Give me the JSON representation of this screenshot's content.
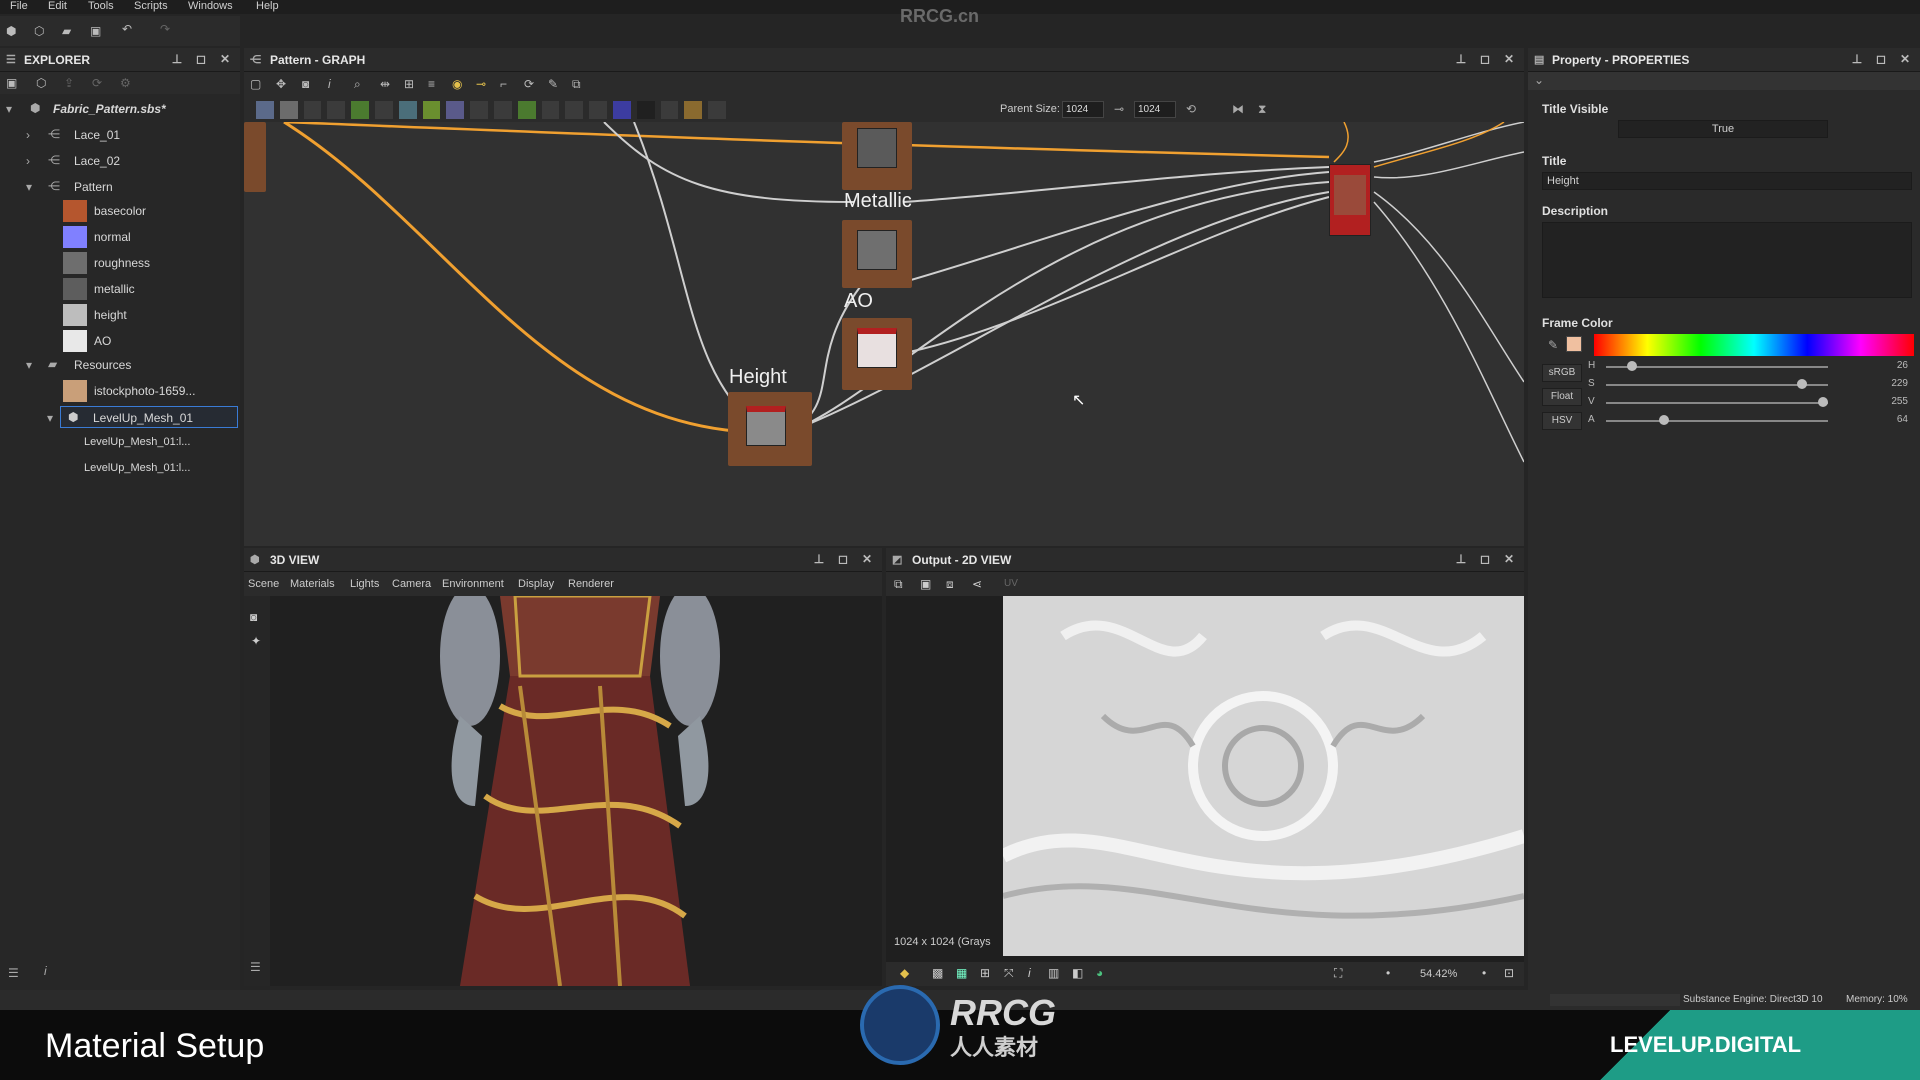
{
  "menu": [
    "File",
    "Edit",
    "Tools",
    "Scripts",
    "Windows",
    "Help"
  ],
  "watermark_top": "RRCG.cn",
  "explorer": {
    "title": "EXPLORER",
    "root": "Fabric_Pattern.sbs*",
    "items": [
      {
        "label": "Lace_01"
      },
      {
        "label": "Lace_02"
      },
      {
        "label": "Pattern"
      },
      {
        "label": "basecolor",
        "swatch": "#b5562e"
      },
      {
        "label": "normal",
        "swatch": "#8080ff"
      },
      {
        "label": "roughness",
        "swatch": "#6e6e6e"
      },
      {
        "label": "metallic",
        "swatch": "#5d5d5d"
      },
      {
        "label": "height",
        "swatch": "#bdbdbd"
      },
      {
        "label": "AO",
        "swatch": "#e8e8e8"
      },
      {
        "label": "Resources"
      },
      {
        "label": "istockphoto-1659...",
        "swatch": "#c99f79"
      },
      {
        "label": "LevelUp_Mesh_01"
      },
      {
        "label": "LevelUp_Mesh_01:l..."
      },
      {
        "label": "LevelUp_Mesh_01:l..."
      }
    ]
  },
  "graph": {
    "title": "Pattern - GRAPH",
    "parent_size_label": "Parent Size:",
    "parent_size": "1024",
    "size2": "1024",
    "nodes": [
      {
        "title": "Metallic"
      },
      {
        "title": "AO"
      },
      {
        "title": "Height"
      }
    ]
  },
  "properties": {
    "title": "Property - PROPERTIES",
    "title_visible_label": "Title Visible",
    "title_visible_value": "True",
    "title_label": "Title",
    "title_value": "Height",
    "description_label": "Description",
    "frame_color_label": "Frame Color",
    "modes": [
      "sRGB",
      "Float",
      "HSV"
    ],
    "sliders": [
      {
        "name": "H",
        "value": "26",
        "fraction": 0.1
      },
      {
        "name": "S",
        "value": "229",
        "fraction": 0.9
      },
      {
        "name": "V",
        "value": "255",
        "fraction": 1.0
      },
      {
        "name": "A",
        "value": "64",
        "fraction": 0.25
      }
    ]
  },
  "view3d": {
    "title": "3D VIEW",
    "tabs": [
      "Scene",
      "Materials",
      "Lights",
      "Camera",
      "Environment",
      "Display",
      "Renderer"
    ]
  },
  "view2d": {
    "title": "Output - 2D VIEW",
    "uv_label": "UV",
    "resolution": "1024 x 1024 (Grays",
    "zoom": "54.42%"
  },
  "status": {
    "engine": "Substance Engine: Direct3D 10",
    "memory": "Memory: 10%"
  },
  "footer": {
    "lower_title": "Material Setup",
    "logo_text": "RRCG",
    "logo_sub": "人人素材",
    "brand": "LEVELUP.DIGITAL"
  },
  "colors": {
    "accent_orange": "#f0a030",
    "frame_brown": "#7a4a2c",
    "selection_border": "#3a7bd5"
  }
}
